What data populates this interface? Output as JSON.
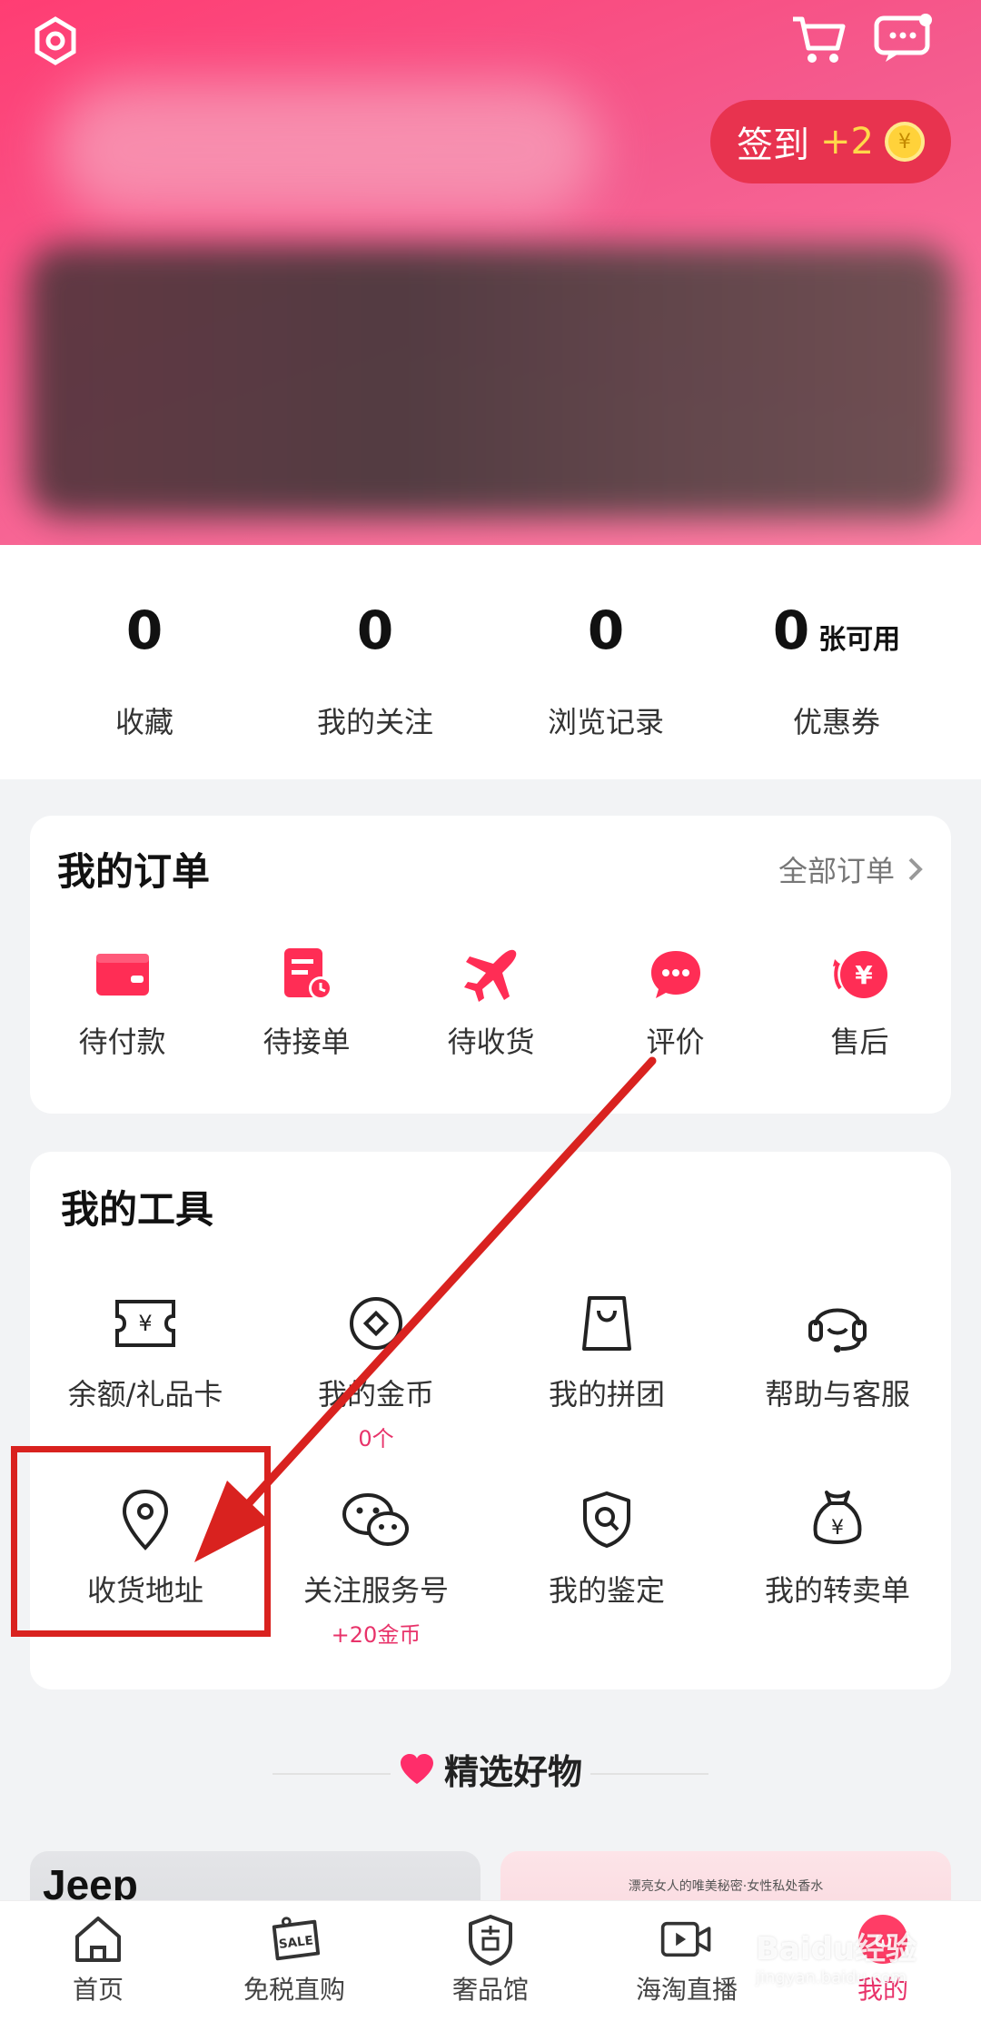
{
  "header": {
    "checkin_label": "签到",
    "checkin_bonus": "+2",
    "coin_symbol": "¥"
  },
  "stats": [
    {
      "value": "0",
      "label": "收藏"
    },
    {
      "value": "0",
      "label": "我的关注"
    },
    {
      "value": "0",
      "label": "浏览记录"
    },
    {
      "value": "0",
      "unit": "张可用",
      "label": "优惠券"
    }
  ],
  "orders": {
    "title": "我的订单",
    "all_label": "全部订单",
    "items": [
      {
        "label": "待付款",
        "icon": "wallet-icon"
      },
      {
        "label": "待接单",
        "icon": "order-clock-icon"
      },
      {
        "label": "待收货",
        "icon": "airplane-icon"
      },
      {
        "label": "评价",
        "icon": "chat-bubble-icon"
      },
      {
        "label": "售后",
        "icon": "refund-icon"
      }
    ]
  },
  "tools": {
    "title": "我的工具",
    "items": [
      {
        "label": "余额/礼品卡",
        "icon": "ticket-icon",
        "sub": ""
      },
      {
        "label": "我的金币",
        "icon": "coin-icon",
        "sub": "0个"
      },
      {
        "label": "我的拼团",
        "icon": "bag-icon",
        "sub": ""
      },
      {
        "label": "帮助与客服",
        "icon": "headset-icon",
        "sub": ""
      },
      {
        "label": "收货地址",
        "icon": "location-pin-icon",
        "sub": ""
      },
      {
        "label": "关注服务号",
        "icon": "wechat-icon",
        "sub": "+20金币"
      },
      {
        "label": "我的鉴定",
        "icon": "shield-search-icon",
        "sub": ""
      },
      {
        "label": "我的转卖单",
        "icon": "money-bag-icon",
        "sub": ""
      }
    ]
  },
  "featured": {
    "title": "精选好物"
  },
  "products": {
    "left_brand": "Jeep",
    "right_caption": "漂亮女人的唯美秘密·女性私处香水"
  },
  "tabbar": {
    "items": [
      {
        "label": "首页",
        "icon": "home-icon"
      },
      {
        "label": "免税直购",
        "icon": "sale-tag-icon"
      },
      {
        "label": "奢品馆",
        "icon": "luxury-shield-icon"
      },
      {
        "label": "海淘直播",
        "icon": "live-video-icon"
      },
      {
        "label": "我的",
        "icon": "avatar-icon"
      }
    ],
    "active_index": 4
  },
  "watermark": {
    "text": "Baidu经验",
    "url": "jingyan.baidu.com"
  },
  "colors": {
    "brand_pink": "#ff3d73",
    "accent_red": "#e8336a",
    "annotation_red": "#d9221f"
  }
}
